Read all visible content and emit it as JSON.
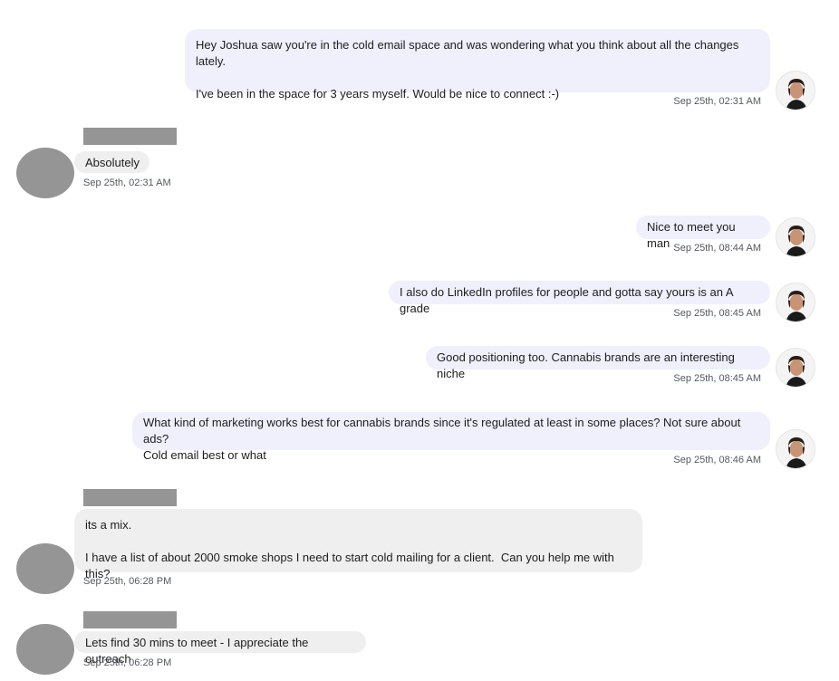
{
  "conversation": {
    "messages": [
      {
        "direction": "out",
        "text": "Hey Joshua saw you're in the cold email space and was wondering what you think about all the changes lately.\n\nI've been in the space for 3 years myself. Would be nice to connect :-)",
        "timestamp": "Sep 25th, 02:31 AM"
      },
      {
        "direction": "in",
        "text": "Absolutely",
        "timestamp": "Sep 25th, 02:31 AM"
      },
      {
        "direction": "out",
        "text": "Nice to meet you man",
        "timestamp": "Sep 25th, 08:44 AM"
      },
      {
        "direction": "out",
        "text": "I also do LinkedIn profiles for people and gotta say yours is an A grade",
        "timestamp": "Sep 25th, 08:45 AM"
      },
      {
        "direction": "out",
        "text": "Good positioning too. Cannabis brands are an interesting niche",
        "timestamp": "Sep 25th, 08:45 AM"
      },
      {
        "direction": "out",
        "text": "What kind of marketing works best for cannabis brands since it's regulated at least in some places? Not sure about ads?\nCold email best or what",
        "timestamp": "Sep 25th, 08:46 AM"
      },
      {
        "direction": "in",
        "text": "its a mix.\n\nI have a list of about 2000 smoke shops I need to start cold mailing for a client.  Can you help me with this?",
        "timestamp": "Sep 25th, 06:28 PM"
      },
      {
        "direction": "in",
        "text": "Lets find 30 mins to meet - I appreciate the outreach",
        "timestamp": "Sep 25th, 06:28 PM"
      }
    ]
  },
  "colors": {
    "outgoing_bubble": "#eff0fc",
    "incoming_bubble": "#efefef",
    "redaction": "#959595"
  }
}
